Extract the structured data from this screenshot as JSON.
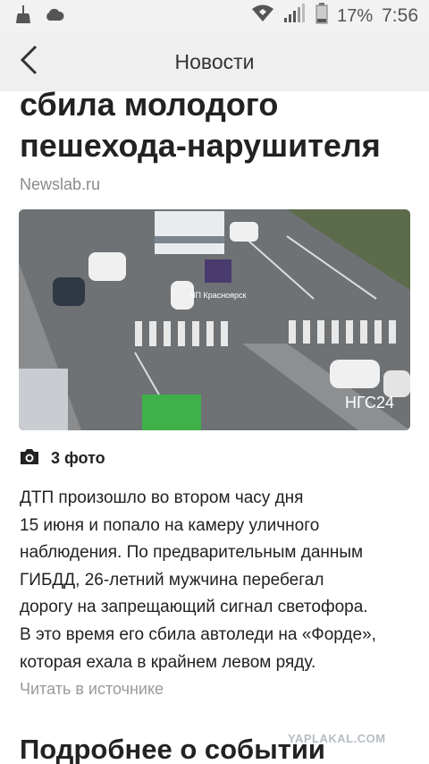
{
  "status_bar": {
    "battery_percent": "17%",
    "time": "7:56",
    "icons": [
      "broom-icon",
      "cloud-icon",
      "wifi-icon",
      "signal-icon",
      "battery-icon"
    ]
  },
  "app_bar": {
    "title": "Новости",
    "back_icon": "back-arrow-icon"
  },
  "article": {
    "headline": "сбила молодого пешехода-нарушителя",
    "source": "Newslab.ru",
    "photo": {
      "overlay_text": "ЧП Красноярск",
      "credit": "НГС24"
    },
    "photo_count": "3 фото",
    "body_lines": [
      "ДТП произошло во втором часу дня",
      "15 июня и попало на камеру уличного",
      "наблюдения. По предварительным данным",
      "ГИБДД, 26-летний мужчина перебегал",
      "дорогу на запрещающий сигнал светофора.",
      "В это время его сбила автоледи на «Форде»,",
      "которая ехала в крайнем левом ряду."
    ],
    "read_source": "Читать в источнике"
  },
  "watermark": "YAPLAKAL.COM",
  "more_section_title": "Подробнее о событии",
  "colors": {
    "status_bar_bg": "#f2f2f2",
    "app_bar_bg": "#efefef",
    "muted_text": "#8a8a8a"
  }
}
